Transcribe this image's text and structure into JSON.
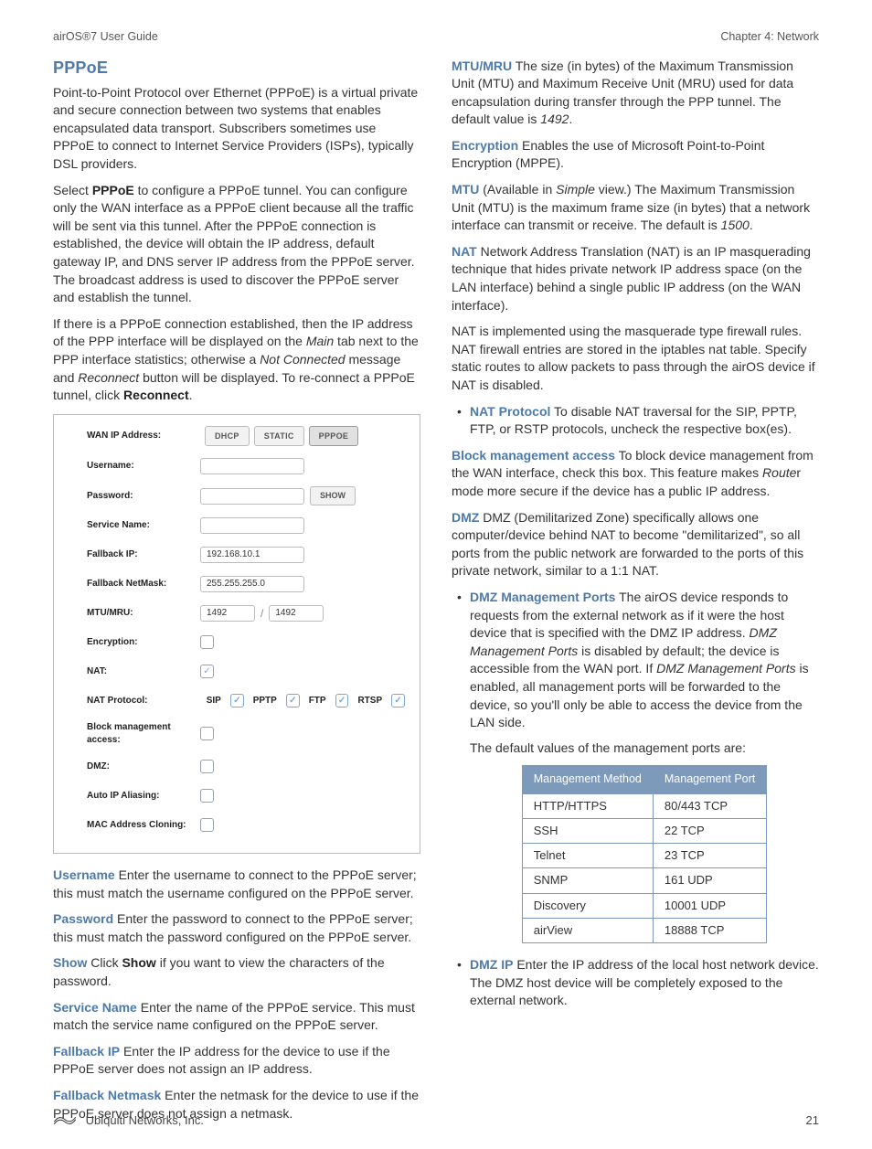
{
  "header": {
    "left": "airOS®7 User Guide",
    "right": "Chapter 4: Network"
  },
  "footer": {
    "company": "Ubiquiti Networks, Inc.",
    "page_number": "21"
  },
  "left": {
    "heading": "PPPoE",
    "p1": "Point-to-Point Protocol over Ethernet (PPPoE) is a virtual private and secure connection between two systems that enables encapsulated data transport. Subscribers sometimes use PPPoE to connect to Internet Service Providers (ISPs), typically DSL providers.",
    "p2_a": "Select ",
    "p2_b": "PPPoE",
    "p2_c": " to configure a PPPoE tunnel. You can configure only the WAN interface as a PPPoE client because all the traffic will be sent via this tunnel. After the PPPoE connection is established, the device will obtain the IP address, default gateway IP, and DNS server IP address from the PPPoE server. The broadcast address is used to discover the PPPoE server and establish the tunnel.",
    "p3_a": "If there is a PPPoE connection established, then the IP address of the PPP interface will be displayed on the ",
    "p3_b": "Main",
    "p3_c": " tab next to the PPP interface statistics; otherwise a ",
    "p3_d": "Not Connected",
    "p3_e": " message and ",
    "p3_f": "Reconnect",
    "p3_g": " button will be displayed. To re-connect a PPPoE tunnel, click ",
    "p3_h": "Reconnect",
    "p3_i": ".",
    "form": {
      "l_wan": "WAN IP Address:",
      "btn_dhcp": "DHCP",
      "btn_static": "STATIC",
      "btn_pppoe": "PPPOE",
      "l_username": "Username:",
      "l_password": "Password:",
      "btn_show": "SHOW",
      "l_service": "Service Name:",
      "l_fallback_ip": "Fallback IP:",
      "v_fallback_ip": "192.168.10.1",
      "l_fallback_mask": "Fallback NetMask:",
      "v_fallback_mask": "255.255.255.0",
      "l_mtu": "MTU/MRU:",
      "v_mtu1": "1492",
      "v_mtu2": "1492",
      "l_enc": "Encryption:",
      "l_nat": "NAT:",
      "l_natproto": "NAT Protocol:",
      "p_sip": "SIP",
      "p_pptp": "PPTP",
      "p_ftp": "FTP",
      "p_rtsp": "RTSP",
      "l_block": "Block management access:",
      "l_dmz": "DMZ:",
      "l_autoip": "Auto IP Aliasing:",
      "l_mac": "MAC Address Cloning:"
    },
    "def": {
      "username_l": "Username",
      "username_t": "  Enter the username to connect to the PPPoE server; this must match the username configured on the PPPoE server.",
      "password_l": "Password",
      "password_t": "  Enter the password to connect to the PPPoE server; this must match the password configured on the PPPoE server.",
      "show_l": "Show",
      "show_t_a": "  Click ",
      "show_t_b": "Show",
      "show_t_c": " if you want to view the characters of the password.",
      "service_l": "Service Name",
      "service_t": "  Enter the name of the PPPoE service. This must match the service name configured on the PPPoE server.",
      "fbip_l": "Fallback IP",
      "fbip_t": "  Enter the IP address for the device to use if the PPPoE server does not assign an IP address.",
      "fbmask_l": "Fallback Netmask",
      "fbmask_t": "  Enter the netmask for the device to use if the PPPoE server does not assign a netmask."
    }
  },
  "right": {
    "mtu_l": "MTU/MRU",
    "mtu_t_a": "  The size (in bytes) of the Maximum Transmission Unit (MTU) and Maximum Receive Unit (MRU) used for data encapsulation during transfer through the PPP tunnel. The default value is ",
    "mtu_t_b": "1492",
    "mtu_t_c": ".",
    "enc_l": "Encryption",
    "enc_t": "  Enables the use of Microsoft Point-to-Point Encryption (MPPE).",
    "mtu2_l": "MTU",
    "mtu2_t_a": "  (Available in ",
    "mtu2_t_b": "Simple",
    "mtu2_t_c": " view.) The Maximum Transmission Unit (MTU) is the maximum frame size (in bytes) that a network interface can transmit or receive. The default is ",
    "mtu2_t_d": "1500",
    "mtu2_t_e": ".",
    "nat_l": "NAT",
    "nat_t": "  Network Address Translation (NAT) is an IP masquerading technique that hides private network IP address space (on the LAN interface) behind a single public IP address (on the WAN interface).",
    "nat2": "NAT is implemented using the masquerade type firewall rules. NAT firewall entries are stored in the iptables nat table. Specify static routes to allow packets to pass through the airOS device if NAT is disabled.",
    "natproto_l": "NAT Protocol",
    "natproto_t": "  To disable NAT traversal for the SIP, PPTP, FTP, or RSTP protocols, uncheck the respective box(es).",
    "block_l": "Block management access",
    "block_t_a": "  To block device management from the WAN interface, check this box. This feature makes ",
    "block_t_b": "Route",
    "block_t_c": "r mode more secure if the device has a public IP address.",
    "dmz_l": "DMZ",
    "dmz_t": "  DMZ (Demilitarized Zone) specifically allows one computer/device behind NAT to become \"demilitarized\", so all ports from the public network are forwarded to the ports of this private network, similar to a 1:1 NAT.",
    "dmzmp_l": "DMZ Management Ports",
    "dmzmp_t_a": "  The airOS device responds to requests from the external network as if it were the host device that is specified with the DMZ IP address. ",
    "dmzmp_t_b": "DMZ Management Ports",
    "dmzmp_t_c": " is disabled by default; the device is accessible from the WAN port. If ",
    "dmzmp_t_d": "DMZ Management Ports",
    "dmzmp_t_e": " is enabled, all management ports will be forwarded to the device, so you'll only be able to access the device from the LAN side.",
    "table_intro": "The default values of the management ports are:",
    "table": {
      "h1": "Management Method",
      "h2": "Management Port",
      "rows": [
        {
          "m": "HTTP/HTTPS",
          "p": "80/443 TCP"
        },
        {
          "m": "SSH",
          "p": "22 TCP"
        },
        {
          "m": "Telnet",
          "p": "23 TCP"
        },
        {
          "m": "SNMP",
          "p": "161 UDP"
        },
        {
          "m": "Discovery",
          "p": "10001 UDP"
        },
        {
          "m": "airView",
          "p": "18888 TCP"
        }
      ]
    },
    "dmzip_l": "DMZ IP",
    "dmzip_t": "  Enter the IP address of the local host network device. The DMZ host device will be completely exposed to the external network."
  }
}
